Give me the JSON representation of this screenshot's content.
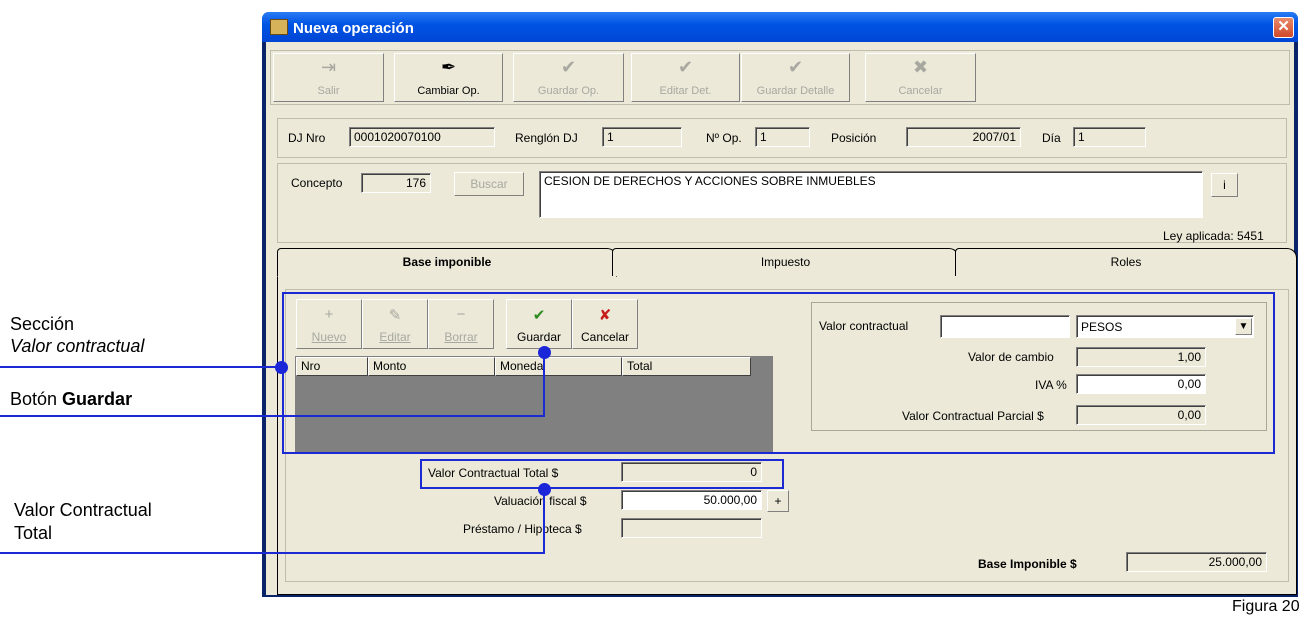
{
  "window": {
    "title": "Nueva operación",
    "close_glyph": "✕"
  },
  "toolbar": [
    {
      "label": "Salir",
      "icon": "exit-door-icon",
      "glyph": "⇥",
      "enabled": false
    },
    {
      "label": "Cambiar Op.",
      "icon": "quill-icon",
      "glyph": "✒",
      "enabled": true
    },
    {
      "label": "Guardar Op.",
      "icon": "check-icon",
      "glyph": "✔",
      "enabled": false
    },
    {
      "label": "Editar Det.",
      "icon": "check-icon",
      "glyph": "✔",
      "enabled": false
    },
    {
      "label": "Guardar Detalle",
      "icon": "check-icon",
      "glyph": "✔",
      "enabled": false
    },
    {
      "label": "Cancelar",
      "icon": "cancel-icon",
      "glyph": "✖",
      "enabled": false
    }
  ],
  "header": {
    "dj_nro_label": "DJ Nro",
    "dj_nro": "0001020070100",
    "renglon_label": "Renglón DJ",
    "renglon": "1",
    "nro_op_label": "Nº Op.",
    "nro_op": "1",
    "posicion_label": "Posición",
    "posicion": "2007/01",
    "dia_label": "Día",
    "dia": "1"
  },
  "concepto": {
    "label": "Concepto",
    "code": "176",
    "buscar_label": "Buscar",
    "description": "CESION DE DERECHOS Y ACCIONES SOBRE INMUEBLES",
    "info_label": "i",
    "ley": "Ley aplicada: 5451"
  },
  "tabs": [
    {
      "label": "Base imponible",
      "active": true
    },
    {
      "label": "Impuesto",
      "active": false
    },
    {
      "label": "Roles",
      "active": false
    }
  ],
  "detail_toolbar": [
    {
      "label": "Nuevo",
      "glyph": "+",
      "icon": "plus-icon",
      "enabled": false
    },
    {
      "label": "Editar",
      "glyph": "✎",
      "icon": "edit-icon",
      "enabled": false
    },
    {
      "label": "Borrar",
      "glyph": "−",
      "icon": "minus-icon",
      "enabled": false
    },
    {
      "label": "Guardar",
      "glyph": "✔",
      "icon": "check-icon",
      "enabled": true
    },
    {
      "label": "Cancelar",
      "glyph": "✘",
      "icon": "cancel-icon",
      "enabled": true
    }
  ],
  "grid": {
    "columns": [
      "Nro",
      "Monto",
      "Moneda",
      "Total"
    ],
    "rows": []
  },
  "valor": {
    "contractual_label": "Valor contractual",
    "contractual": "",
    "moneda": "PESOS",
    "cambio_label": "Valor de cambio",
    "cambio": "1,00",
    "iva_label": "IVA %",
    "iva": "0,00",
    "parcial_label": "Valor Contractual Parcial $",
    "parcial": "0,00"
  },
  "totals": {
    "total_label": "Valor Contractual Total  $",
    "total": "0",
    "valuacion_label": "Valuación fiscal $",
    "valuacion": "50.000,00",
    "plus_label": "+",
    "prestamo_label": "Préstamo / Hipoteca $",
    "prestamo": "",
    "base_label": "Base Imponible $",
    "base": "25.000,00"
  },
  "annotations": {
    "seccion_line1": "Sección",
    "seccion_line2": "Valor contractual",
    "boton_prefix": "Botón ",
    "boton_bold": "Guardar",
    "total_line1": "Valor Contractual",
    "total_line2": "Total",
    "figura": "Figura 20"
  },
  "colors": {
    "annotation_blue": "#1c2ad6",
    "title_blue": "#0054e3",
    "grid_dark": "#808080"
  }
}
